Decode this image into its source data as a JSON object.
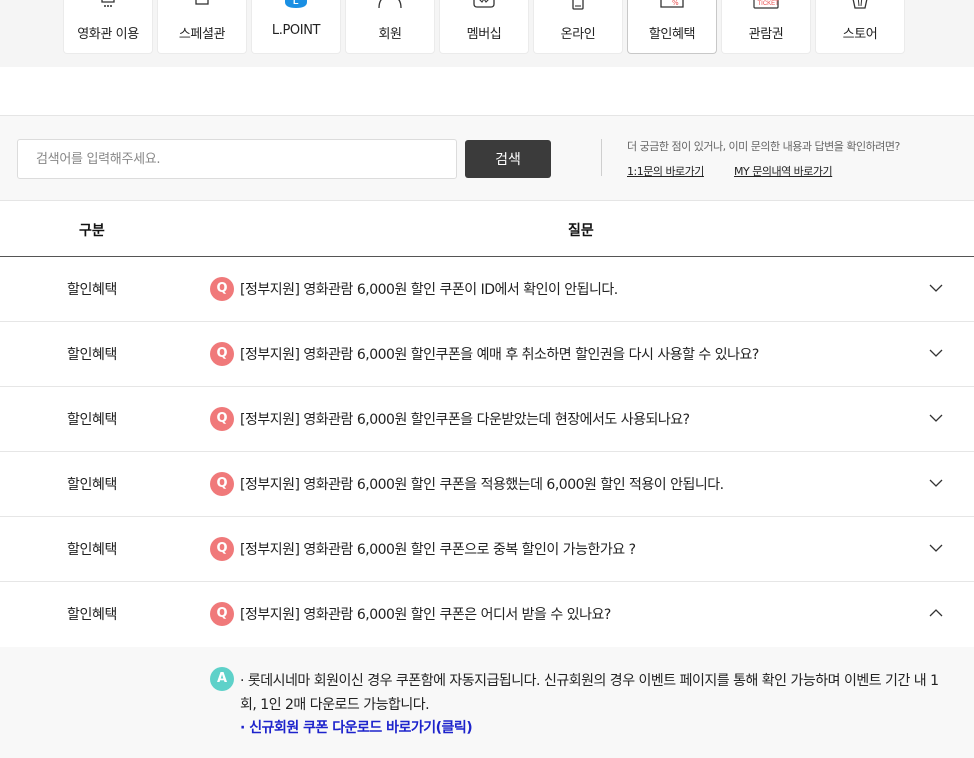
{
  "tabs": [
    {
      "label": "영화관 이용",
      "icon": "cinema-icon"
    },
    {
      "label": "스페셜관",
      "icon": "special-hall-icon"
    },
    {
      "label": "L.POINT",
      "icon": "lpoint-icon"
    },
    {
      "label": "회원",
      "icon": "member-icon"
    },
    {
      "label": "멤버십",
      "icon": "membership-icon"
    },
    {
      "label": "온라인",
      "icon": "mobile-icon"
    },
    {
      "label": "할인혜택",
      "icon": "discount-coupon-icon"
    },
    {
      "label": "관람권",
      "icon": "ticket-icon"
    },
    {
      "label": "스토어",
      "icon": "popcorn-icon"
    }
  ],
  "active_tab": "할인혜택",
  "ticket_icon_text": "TICKET",
  "search": {
    "placeholder": "검색어를 입력해주세요.",
    "button": "검색",
    "help_text": "더 궁금한 점이 있거나, 이미 문의한 내용과 답변을 확인하려면?",
    "link_inquiry": "1:1문의 바로가기",
    "link_my_inquiries": "MY 문의내역 바로가기"
  },
  "table": {
    "col_category": "구분",
    "col_question": "질문"
  },
  "faq": [
    {
      "category": "할인혜택",
      "badge": "Q",
      "question": "[정부지원] 영화관람 6,000원 할인 쿠폰이 ID에서 확인이 안됩니다.",
      "expanded": false
    },
    {
      "category": "할인혜택",
      "badge": "Q",
      "question": "[정부지원] 영화관람 6,000원 할인쿠폰을 예매 후 취소하면 할인권을 다시 사용할 수 있나요?",
      "expanded": false
    },
    {
      "category": "할인혜택",
      "badge": "Q",
      "question": "[정부지원] 영화관람 6,000원 할인쿠폰을 다운받았는데 현장에서도 사용되나요?",
      "expanded": false
    },
    {
      "category": "할인혜택",
      "badge": "Q",
      "question": "[정부지원] 영화관람 6,000원 할인 쿠폰을 적용했는데 6,000원 할인 적용이 안됩니다.",
      "expanded": false
    },
    {
      "category": "할인혜택",
      "badge": "Q",
      "question": "[정부지원] 영화관람 6,000원 할인 쿠폰으로 중복 할인이 가능한가요 ?",
      "expanded": false
    },
    {
      "category": "할인혜택",
      "badge": "Q",
      "question": "[정부지원] 영화관람 6,000원 할인 쿠폰은 어디서 받을 수 있나요?",
      "expanded": true
    }
  ],
  "answer": {
    "badge": "A",
    "text": "· 롯데시네마 회원이신 경우 쿠폰함에 자동지급됩니다. 신규회원의 경우 이벤트 페이지를 통해 확인 가능하며 이벤트 기간 내 1회, 1인 2매 다운로드 가능합니다.",
    "link": "· 신규회원 쿠폰 다운로드 바로가기(클릭)"
  },
  "colors": {
    "q_badge": "#f0797a",
    "a_badge": "#5ed1c9",
    "search_button": "#3b3b3b",
    "answer_link": "#1d23cc",
    "lpoint_blue": "#1a8fe3"
  }
}
